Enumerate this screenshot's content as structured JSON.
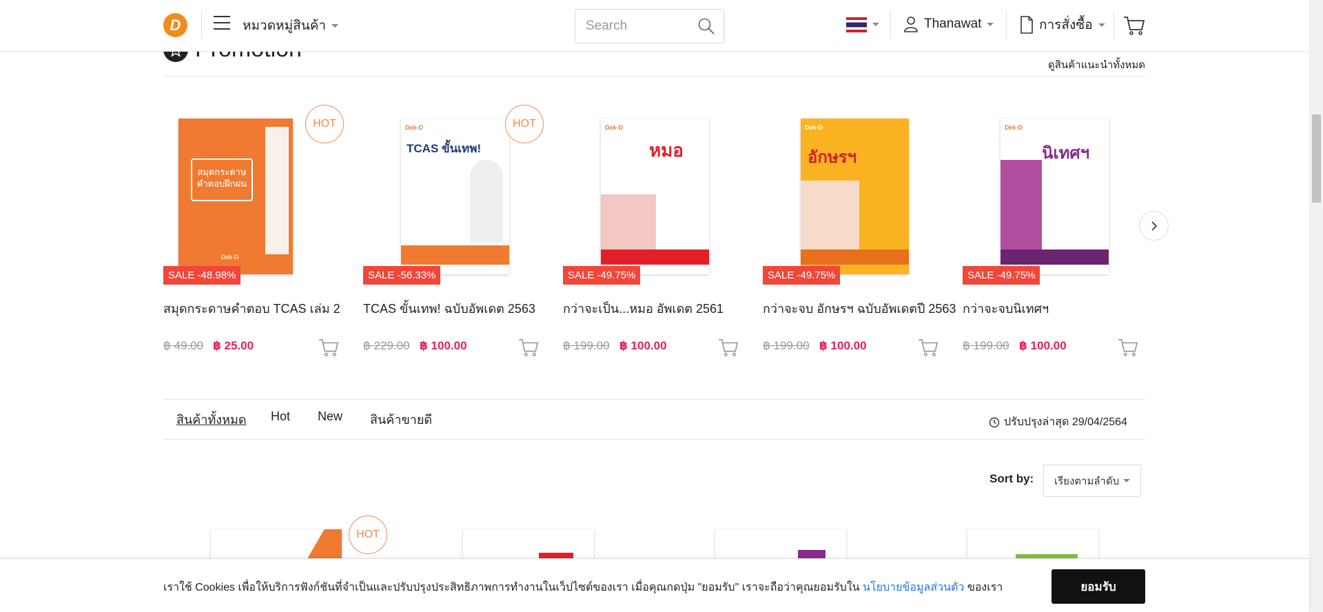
{
  "header": {
    "logo_letter": "D",
    "category_menu": "หมวดหมู่สินค้า",
    "search_placeholder": "Search",
    "user_name": "Thanawat",
    "orders_label": "การสั่งซื้อ"
  },
  "promotion": {
    "title": "Promotion",
    "see_all": "ดูสินค้าแนะนำทั้งหมด",
    "products": [
      {
        "name": "สมุดกระดาษคำตอบ TCAS เล่ม 2",
        "sale": "SALE -48.98%",
        "old_price": "฿ 49.00",
        "new_price": "฿ 25.00",
        "hot": "HOT",
        "cover_title": "สมุดกระดาษ คำตอบฝึกฝน",
        "cover_brand": "Dek-D"
      },
      {
        "name": "TCAS ขั้นเทพ! ฉบับอัพเดต 2563",
        "sale": "SALE -56.33%",
        "old_price": "฿ 229.00",
        "new_price": "฿ 100.00",
        "hot": "HOT",
        "cover_title": "TCAS ขั้นเทพ!",
        "cover_brand": "Dek-D"
      },
      {
        "name": "กว่าจะเป็น...หมอ อัพเดต 2561",
        "sale": "SALE -49.75%",
        "old_price": "฿ 199.00",
        "new_price": "฿ 100.00",
        "cover_title": "หมอ",
        "cover_brand": "Dek-D"
      },
      {
        "name": "กว่าจะจบ อักษรฯ ฉบับอัพเดตปี 2563",
        "sale": "SALE -49.75%",
        "old_price": "฿ 199.00",
        "new_price": "฿ 100.00",
        "cover_title": "อักษรฯ",
        "cover_brand": "Dek-D"
      },
      {
        "name": "กว่าจะจบนิเทศฯ",
        "sale": "SALE -49.75%",
        "old_price": "฿ 199.00",
        "new_price": "฿ 100.00",
        "cover_title": "นิเทศฯ",
        "cover_brand": "Dek-D"
      }
    ]
  },
  "tabs": {
    "items": [
      "สินค้าทั้งหมด",
      "Hot",
      "New",
      "สินค้าขายดี"
    ],
    "updated": "ปรับปรุงล่าสุด 29/04/2564"
  },
  "sort": {
    "label": "Sort by:",
    "selected": "เรียงตามลำดับ"
  },
  "lower": {
    "hot": "HOT"
  },
  "cookie": {
    "text_before": "เราใช้ Cookies เพื่อให้บริการฟังก์ชันที่จำเป็นและปรับปรุงประสิทธิภาพการทำงานในเว็ปไซต์ของเรา เมื่อคุณกดปุ่ม \"ยอมรับ\" เราจะถือว่าคุณยอมรับใน",
    "link": "นโยบายข้อมูลส่วนตัว",
    "text_after": "ของเรา",
    "accept": "ยอมรับ"
  },
  "colors": {
    "brand_orange": "#f38b1c",
    "sale_red": "#f0473b",
    "price_pink": "#e91d5b",
    "hot_orange": "#f08a4b",
    "link_blue": "#1a73e8"
  }
}
